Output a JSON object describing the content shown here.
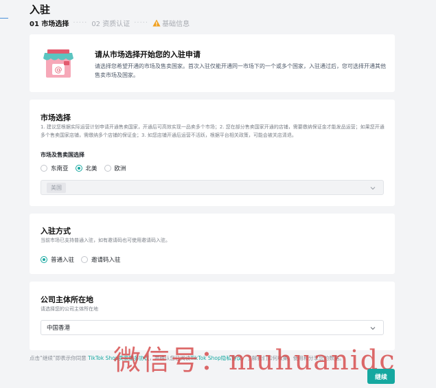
{
  "header": {
    "title": "入驻",
    "steps": [
      "01 市场选择",
      "02 资质认证",
      "基础信息"
    ],
    "step_separator": "·····"
  },
  "hero": {
    "title": "请从市场选择开始您的入驻申请",
    "description": "请选择您希望开通的市场及售卖国家。首次入驻仅能开通同一市场下的一个或多个国家，入驻通过后，您可选择开通其他售卖市场及国家。"
  },
  "market": {
    "title": "市场选择",
    "description": "1. 建议您根据实际运营计划申请开通售卖国家，开通后可高效实现一品卖多个市场；2. 您在部分售卖国家开通的店铺，需要缴纳保证金才能发品运营；如果您开通多个售卖国家店铺，需缴纳多个店铺的保证金；3. 如您店铺开通后运营不活跃，根据平台相关政策，可能会被关店清退。",
    "sub_label": "市场及售卖国选择",
    "options": [
      "东南亚",
      "北美",
      "欧洲"
    ],
    "selected": "北美",
    "country_value": "美国"
  },
  "join": {
    "title": "入驻方式",
    "description": "当前市场已支持普通入驻，如有邀请码也可使用邀请码入驻。",
    "options": [
      "普通入驻",
      "邀请码入驻"
    ],
    "selected": "普通入驻"
  },
  "company": {
    "title": "公司主体所在地",
    "description": "请选择您的公司主体所在地",
    "value": "中国香港"
  },
  "footer": {
    "prefix": "点击“继续”即表示你同意",
    "link1": "TikTok Shop卖家服务协议",
    "middle": "，并确认您已阅读",
    "link2": "TikTok Shop隐私协议",
    "suffix": "，了解我们如何收集、使用和分享您的数据。"
  },
  "continue_label": "继续",
  "watermark": "微信号：muhuanidc",
  "colors": {
    "accent": "#16a8a0",
    "warning": "#f0a020",
    "watermark": "#d64848"
  }
}
